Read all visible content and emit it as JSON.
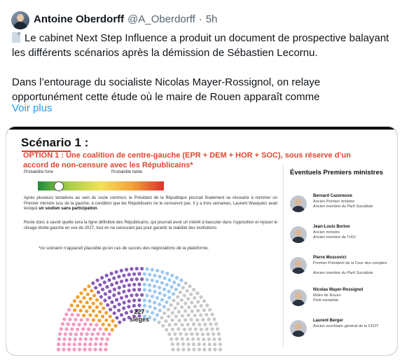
{
  "tweet": {
    "author_name": "Antoine Oberdorff",
    "author_handle": "@A_Oberdorff",
    "separator": "·",
    "time": "5h",
    "icon": "page-facing-up-icon",
    "paragraph1": "Le cabinet Next Step Influence a produit un document de prospective balayant les différents scénarios après la démission de Sébastien Lecornu.",
    "paragraph2": "Dans l’entourage du socialiste Nicolas Mayer-Rossignol, on relaye opportunément cette étude où le maire de Rouen apparaît comme",
    "more_label": "Voir plus"
  },
  "document": {
    "title": "Scénario 1 :",
    "option": "OPTION 1 : Une coalition de centre-gauche (EPR + DEM + HOR + SOC), sous réserve d’un accord de non-censure avec les Républicains*",
    "prob_high": "Probabilité forte",
    "prob_low": "Probabilité faible",
    "probability_marker_fraction": 0.16,
    "para1_a": "Après plusieurs tentatives au sein du socle commun, le Président de la République pourrait finalement se résoudre à nommer un Premier ministre issu de la gauche, à condition que les Républicains ne le censurent pas. Il y a trois semaines, Laurent Wauquiez avait évoqué ",
    "para1_b": "un soutien sans participation",
    "para1_c": ".",
    "para2": "Reste donc à savoir quelle sera la ligne définitive des Républicains, qui pourrait avoir un intérêt à basculer dans l’opposition et rejouer le clivage droite-gauche en vue de 2027, tout en ne censurant pas pour garantir la stabilité des institutions.",
    "note": "*ce scénario n’apparaît plausible qu’en cas de succès des négociations de la plateforme.",
    "seats_count": "227",
    "seats_label": "sièges",
    "side_title": "Éventuels Premiers ministres",
    "colors": {
      "accent": "#e0462f",
      "seat_pink": "#f29bc0",
      "seat_orange": "#f0a030",
      "seat_purple": "#8a5bb8",
      "seat_blue": "#9ec8f0",
      "seat_grey": "#c8c8c8"
    },
    "ministers": [
      {
        "name": "Bernard Cazeneuve",
        "role": "Ancien Premier ministre",
        "role2": "Ancien membre du Parti Socialiste"
      },
      {
        "name": "Jean-Louis Borloo",
        "role": "Ancien ministre",
        "role2": "Ancien membre de l’UDI"
      },
      {
        "name": "Pierre Moscovici",
        "role": "Premier Président de la Cour des comptes",
        "role2": "Ancien membre du Parti Socialiste"
      },
      {
        "name": "Nicolas Mayer-Rossignol",
        "role": "Maire de Rouen",
        "role2": "Parti socialiste"
      },
      {
        "name": "Laurent Berger",
        "role": "Ancien secrétaire général de la CFDT",
        "role2": ""
      }
    ]
  }
}
